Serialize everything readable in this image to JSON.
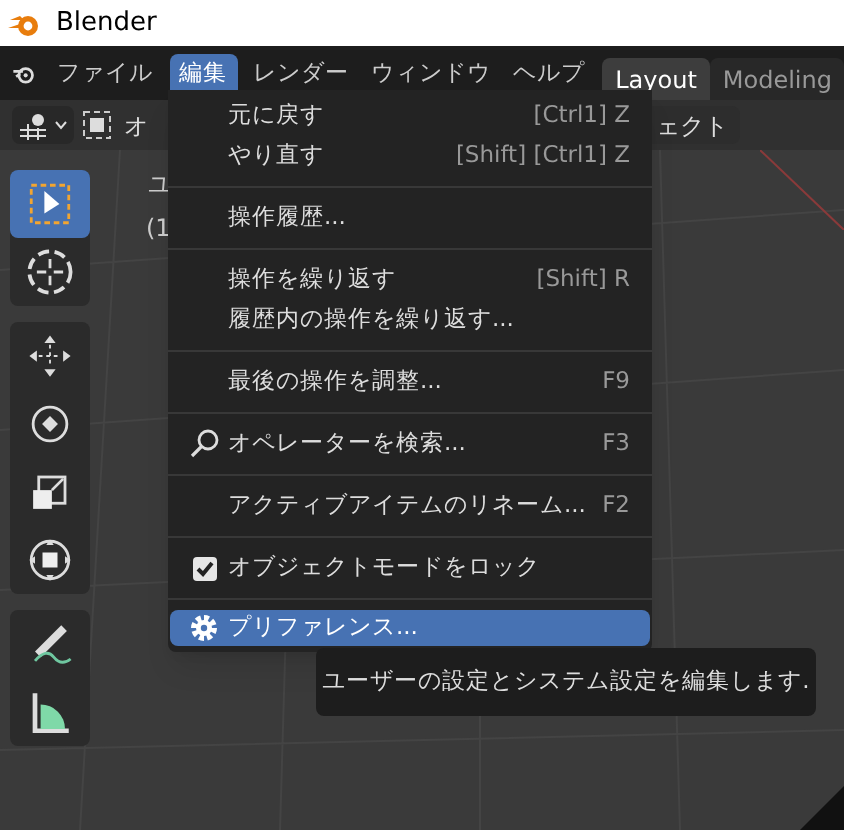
{
  "window": {
    "title": "Blender"
  },
  "menubar": {
    "items": [
      {
        "label": "ファイル",
        "selected": false
      },
      {
        "label": "編集",
        "selected": true
      },
      {
        "label": "レンダー",
        "selected": false
      },
      {
        "label": "ウィンドウ",
        "selected": false
      },
      {
        "label": "ヘルプ",
        "selected": false
      }
    ],
    "workspace_tabs": [
      {
        "label": "Layout",
        "selected": true
      },
      {
        "label": "Modeling",
        "selected": false
      }
    ]
  },
  "tool_header": {
    "mode_label": "オ",
    "object_menu": "ェクト"
  },
  "viewport_overlay": [
    "ユ",
    "(1"
  ],
  "toolbar": [
    {
      "kind": "select",
      "selected": true
    },
    {
      "kind": "cursor",
      "selected": false
    },
    {
      "kind": "move",
      "selected": false
    },
    {
      "kind": "rotate",
      "selected": false
    },
    {
      "kind": "scale",
      "selected": false
    },
    {
      "kind": "transform",
      "selected": false
    },
    {
      "kind": "annotate",
      "selected": false
    },
    {
      "kind": "measure",
      "selected": false
    }
  ],
  "edit_menu": {
    "groups": [
      [
        {
          "kind": "plain",
          "label": "元に戻す",
          "shortcut": "[Ctrl1] Z",
          "selected": false
        },
        {
          "kind": "plain",
          "label": "やり直す",
          "shortcut": "[Shift] [Ctrl1] Z",
          "selected": false
        }
      ],
      [
        {
          "kind": "plain",
          "label": "操作履歴...",
          "selected": false
        }
      ],
      [
        {
          "kind": "plain",
          "label": "操作を繰り返す",
          "shortcut": "[Shift] R",
          "selected": false
        },
        {
          "kind": "plain",
          "label": "履歴内の操作を繰り返す...",
          "selected": false
        }
      ],
      [
        {
          "kind": "plain",
          "label": "最後の操作を調整...",
          "shortcut": "F9",
          "selected": false
        }
      ],
      [
        {
          "kind": "search",
          "label": "オペレーターを検索...",
          "shortcut": "F3",
          "selected": false
        }
      ],
      [
        {
          "kind": "plain",
          "label": "アクティブアイテムのリネーム...",
          "shortcut": "F2",
          "selected": false
        }
      ],
      [
        {
          "kind": "check",
          "label": "オブジェクトモードをロック",
          "checked": true,
          "selected": false
        }
      ],
      [
        {
          "kind": "settings",
          "label": "プリファレンス...",
          "selected": true
        }
      ]
    ]
  },
  "tooltip": {
    "text": "ユーザーの設定とシステム設定を編集します."
  }
}
